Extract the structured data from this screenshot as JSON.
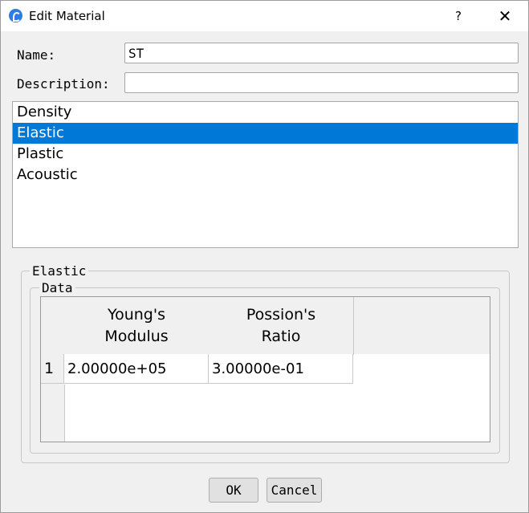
{
  "window": {
    "title": "Edit Material",
    "help_label": "?",
    "close_label": "✕"
  },
  "form": {
    "name_label": "Name:",
    "name_value": "ST",
    "description_label": "Description:",
    "description_value": ""
  },
  "properties": {
    "items": [
      {
        "label": "Density",
        "selected": false
      },
      {
        "label": "Elastic",
        "selected": true
      },
      {
        "label": "Plastic",
        "selected": false
      },
      {
        "label": "Acoustic",
        "selected": false
      }
    ]
  },
  "elastic": {
    "group_title": "Elastic",
    "data_group_title": "Data",
    "columns": [
      "Young's\nModulus",
      "Possion's\nRatio"
    ],
    "rows": [
      {
        "index": "1",
        "values": [
          "2.00000e+05",
          "3.00000e-01"
        ]
      }
    ]
  },
  "buttons": {
    "ok": "OK",
    "cancel": "Cancel"
  },
  "colors": {
    "selection": "#0078d7",
    "dialog_bg": "#f0f0f0"
  }
}
